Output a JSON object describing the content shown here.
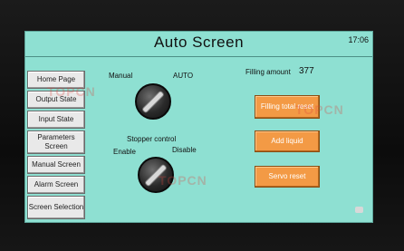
{
  "screen": {
    "title": "Auto Screen",
    "clock": "17:06"
  },
  "sidebar": {
    "items": [
      {
        "label": "Home Page"
      },
      {
        "label": "Output State"
      },
      {
        "label": "Input State"
      },
      {
        "label": "Parameters Screen"
      },
      {
        "label": "Manual Screen"
      },
      {
        "label": "Alarm Screen"
      },
      {
        "label": "Screen Selection"
      }
    ]
  },
  "mode_switch": {
    "left_label": "Manual",
    "right_label": "AUTO"
  },
  "stopper_switch": {
    "title": "Stopper control",
    "left_label": "Enable",
    "right_label": "Disable"
  },
  "filling": {
    "label": "Filling amount",
    "value": "377"
  },
  "actions": {
    "filling_total_reset": "Filling total reset",
    "add_liquid": "Add liquid",
    "servo_reset": "Servo reset"
  },
  "watermark": "TOPCN",
  "colors": {
    "screen_bg": "#8ee0d2",
    "action_button": "#f39a45",
    "sidebar_button": "#e9e9e9"
  }
}
